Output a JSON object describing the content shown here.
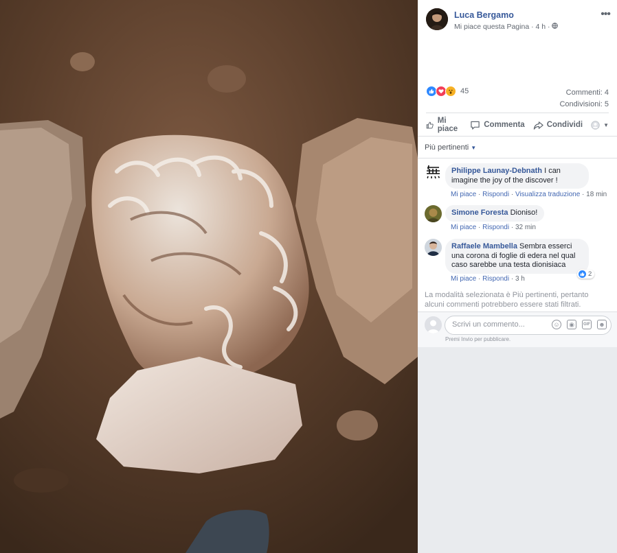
{
  "post": {
    "author": "Luca Bergamo",
    "page_status": "Mi piace questa Pagina",
    "time": "4 h"
  },
  "reactions": {
    "count": "45",
    "types": [
      "like-icon",
      "love-icon",
      "wow-icon"
    ]
  },
  "counts": {
    "comments": "Commenti: 4",
    "shares": "Condivisioni: 5"
  },
  "actions": {
    "like": "Mi piace",
    "comment": "Commenta",
    "share": "Condividi"
  },
  "filter": {
    "label": "Più pertinenti"
  },
  "comments": [
    {
      "author": "Philippe Launay-Debnath",
      "text": "I can imagine the joy of the discover !",
      "like": "Mi piace",
      "reply": "Rispondi",
      "translate": "Visualizza traduzione",
      "time": "18 min"
    },
    {
      "author": "Simone Foresta",
      "text": "Dioniso!",
      "like": "Mi piace",
      "reply": "Rispondi",
      "time": "32 min"
    },
    {
      "author": "Raffaele Mambella",
      "text": "Sembra esserci una corona di foglie di edera nel qual caso sarebbe una testa dionisiaca",
      "like": "Mi piace",
      "reply": "Rispondi",
      "time": "3 h",
      "likes": "2"
    }
  ],
  "note": "La modalità selezionata è Più pertinenti, pertanto alcuni commenti potrebbero essere stati filtrati.",
  "composer": {
    "placeholder": "Scrivi un commento...",
    "hint": "Premi Invio per pubblicare."
  },
  "colors": {
    "link": "#365899",
    "like_blue": "#2d88ff",
    "love_red": "#f33e58",
    "wow_yellow": "#f7b125"
  }
}
